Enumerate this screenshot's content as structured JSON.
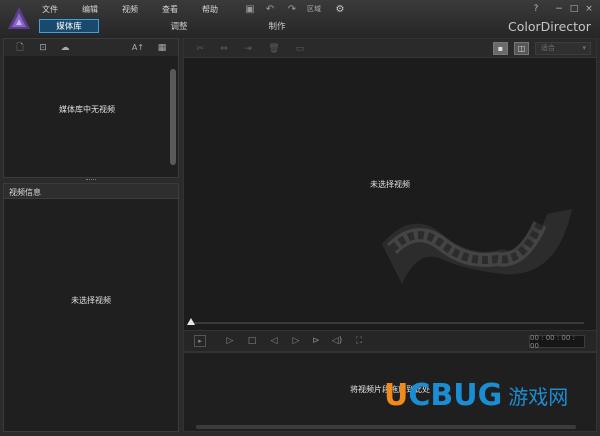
{
  "app": {
    "brand": "ColorDirector",
    "menu": [
      "文件",
      "编辑",
      "视频",
      "查看",
      "帮助"
    ],
    "region_label": "区域",
    "help_icon": "?",
    "minimize_icon": "−",
    "maximize_icon": "□",
    "close_icon": "×"
  },
  "tabs": {
    "library": "媒体库",
    "adjust": "调整",
    "produce": "制作"
  },
  "library": {
    "empty_text": "媒体库中无视频",
    "sort_label": "A↑"
  },
  "info": {
    "title": "视频信息",
    "empty_text": "未选择视频"
  },
  "preview": {
    "empty_text": "未选择视频",
    "fit_label": "适合",
    "timecode": "00 : 00 : 00 : 00"
  },
  "bottom": {
    "hint": "将视频片段拖放到此处"
  },
  "watermark": {
    "u": "U",
    "c": "C",
    "bug": "BUG",
    "cn": "游戏网"
  },
  "colors": {
    "accent": "#3aa0e0",
    "wm_blue": "#1b8ed3",
    "wm_orange": "#f08a1c"
  }
}
